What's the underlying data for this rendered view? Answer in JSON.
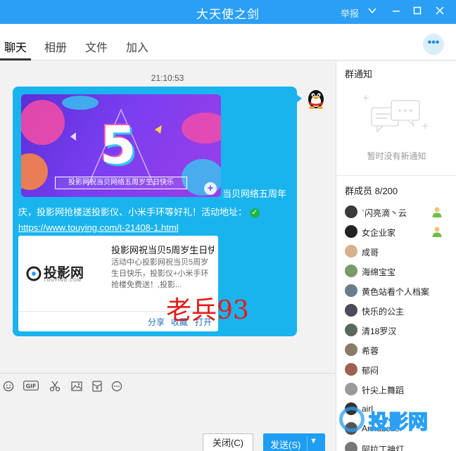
{
  "window": {
    "title": "大天使之剑",
    "report_label": "举报"
  },
  "tabs": [
    {
      "label": "聊天"
    },
    {
      "label": "相册"
    },
    {
      "label": "文件"
    },
    {
      "label": "加入"
    }
  ],
  "chat": {
    "timestamp": "21:10:53",
    "banner_caption": "投影网祝当贝网络五周岁生日快乐",
    "message_line1": "当贝网络五周年",
    "message_line2": "庆，投影网抢楼送投影仪、小米手环等好礼！活动地址：",
    "link": "https://www.touying.com/t-21408-1.html",
    "card": {
      "logo_text": "投影网",
      "logo_sub": "TOUYING.COM",
      "title": "投影网祝当贝5周岁生日快乐...",
      "desc": "活动中心投影网祝当贝5周岁生日快乐，投影仪+小米手环抢楼免费送！,投影...",
      "actions": [
        "分享",
        "收藏",
        "打开"
      ]
    },
    "overlay_text": "老兵93"
  },
  "composer": {
    "close_label": "关闭(C)",
    "send_label": "发送(S)"
  },
  "sidebar": {
    "notice_title": "群通知",
    "notice_empty": "暂时没有新通知",
    "members_title": "群成员 8/200",
    "members": [
      {
        "name": "`闪亮滴丶云",
        "avatar_color": "#3a3a3a",
        "role": "admin"
      },
      {
        "name": "女企业家",
        "avatar_color": "#222222",
        "role": "admin"
      },
      {
        "name": "成哥",
        "avatar_color": "#d8b08a",
        "role": ""
      },
      {
        "name": "海绵宝宝",
        "avatar_color": "#7a9a6a",
        "role": ""
      },
      {
        "name": "黄色站看个人档案",
        "avatar_color": "#6b7d8a",
        "role": ""
      },
      {
        "name": "快乐的公主",
        "avatar_color": "#4a4a5a",
        "role": ""
      },
      {
        "name": "清18罗汉",
        "avatar_color": "#5a6a5a",
        "role": ""
      },
      {
        "name": "希蓉",
        "avatar_color": "#8a7a6a",
        "role": ""
      },
      {
        "name": "郁闷",
        "avatar_color": "#a06050",
        "role": ""
      },
      {
        "name": "针尖上舞蹈",
        "avatar_color": "#9a9a9a",
        "role": ""
      },
      {
        "name": "airl",
        "avatar_color": "#333333",
        "role": ""
      },
      {
        "name": "Annabelle",
        "avatar_color": "#555555",
        "role": ""
      },
      {
        "name": "阿拉丁神灯",
        "avatar_color": "#777777",
        "role": ""
      }
    ]
  },
  "watermark": {
    "text": "投影网"
  },
  "colors": {
    "titlebar": "#2a9ff5",
    "bubble": "#19b4ee",
    "send": "#1e9df2"
  }
}
